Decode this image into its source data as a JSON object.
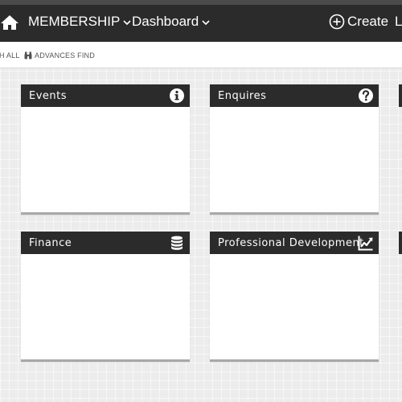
{
  "navbar": {
    "home_icon": "home-icon",
    "menus": [
      {
        "label": "MEMBERSHIP"
      },
      {
        "label": "Dashboard"
      }
    ],
    "create_label": "Create",
    "cut_label": "L"
  },
  "searchbar": {
    "search_all_label": "H ALL",
    "advanced_find_label": "ADVANCES FIND"
  },
  "cards": [
    {
      "title": "Events",
      "icon": "info-icon"
    },
    {
      "title": "Enquires",
      "icon": "question-icon"
    },
    {
      "title": "Finance",
      "icon": "database-icon"
    },
    {
      "title": "Professional Development",
      "icon": "line-chart-icon"
    }
  ],
  "colors": {
    "navbar": "#2b2b2b",
    "card_header": "#2b2b2b",
    "background": "#ececec"
  }
}
